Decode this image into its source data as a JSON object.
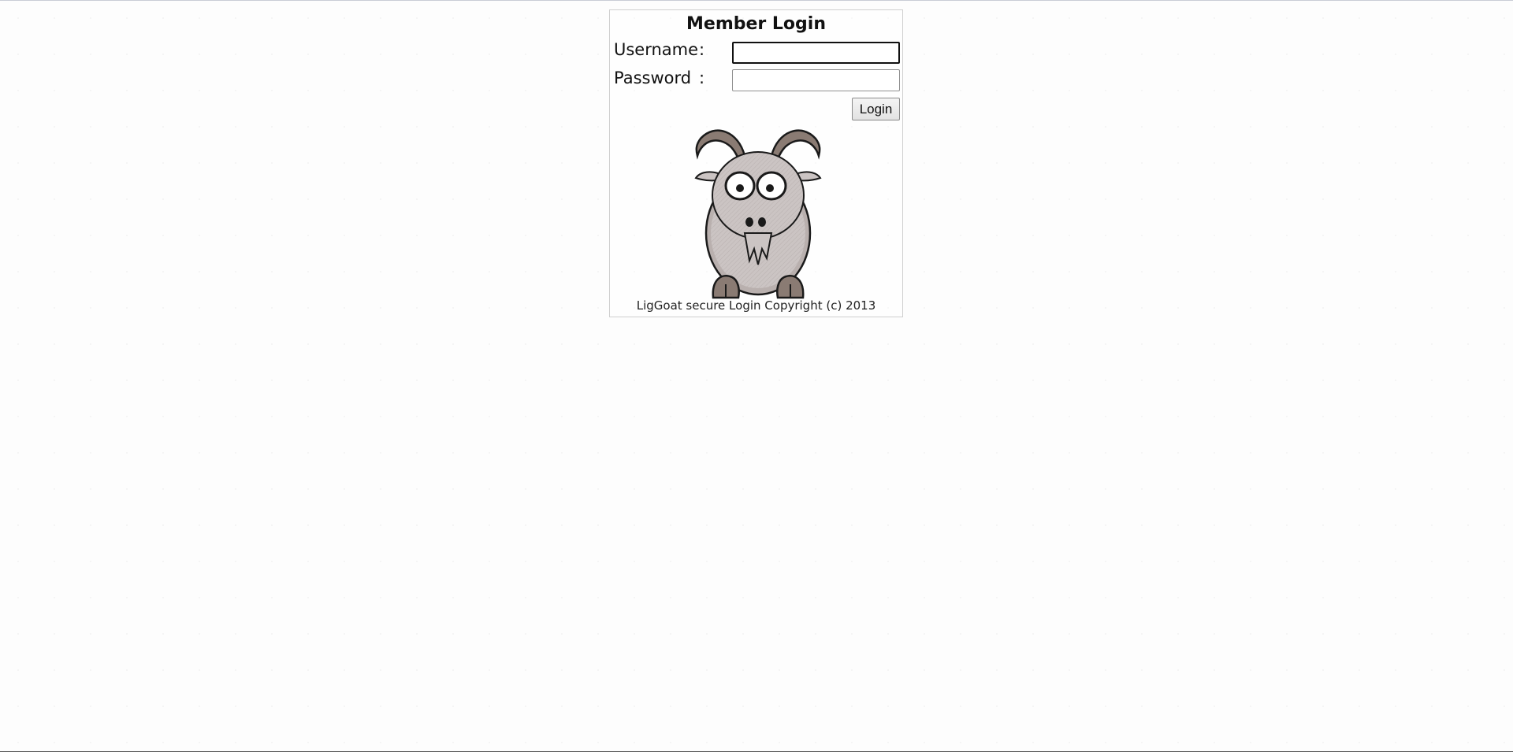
{
  "login": {
    "title": "Member Login",
    "username_label": "Username",
    "password_label": "Password",
    "colon": ":",
    "username_value": "",
    "password_value": "",
    "button_label": "Login",
    "logo_icon": "goat-cartoon-icon",
    "footer": "LigGoat secure Login Copyright (c) 2013"
  }
}
